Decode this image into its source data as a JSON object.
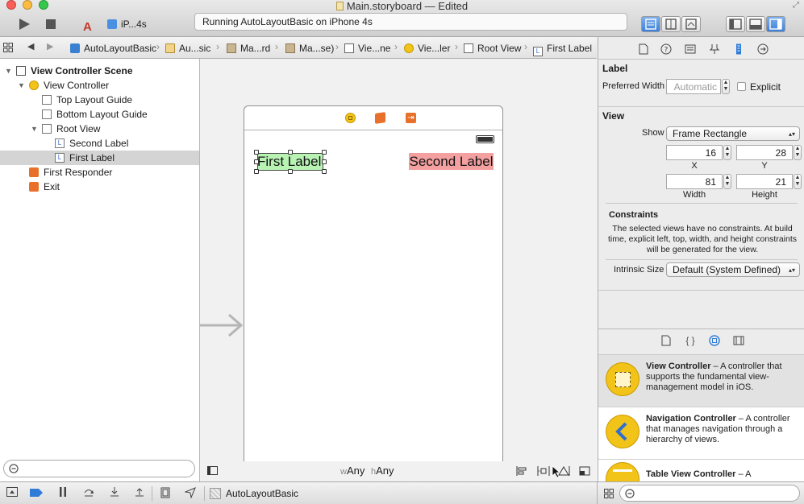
{
  "window": {
    "title": "Main.storyboard — Edited",
    "scheme_target": "iP...4s",
    "activity": "Running AutoLayoutBasic on iPhone 4s"
  },
  "jumpbar": {
    "crumbs": [
      "AutoLayoutBasic",
      "Au...sic",
      "Ma...rd",
      "Ma...se)",
      "Vie...ne",
      "Vie...ler",
      "Root View",
      "First Label"
    ]
  },
  "outline": {
    "items": [
      {
        "label": "View Controller Scene",
        "level": 0,
        "bold": true,
        "icon": "scene-icon"
      },
      {
        "label": "View Controller",
        "level": 1,
        "icon": "view-controller-icon"
      },
      {
        "label": "Top Layout Guide",
        "level": 2,
        "icon": "layout-guide-icon"
      },
      {
        "label": "Bottom Layout Guide",
        "level": 2,
        "icon": "layout-guide-icon"
      },
      {
        "label": "Root View",
        "level": 2,
        "icon": "view-icon"
      },
      {
        "label": "Second Label",
        "level": 3,
        "icon": "label-icon"
      },
      {
        "label": "First Label",
        "level": 3,
        "icon": "label-icon",
        "selected": true
      },
      {
        "label": "First Responder",
        "level": 1,
        "icon": "first-responder-icon"
      },
      {
        "label": "Exit",
        "level": 1,
        "icon": "exit-icon"
      }
    ]
  },
  "canvas": {
    "first_label": "First Label",
    "second_label": "Second Label",
    "size_class_w_prefix": "w",
    "size_class_w": "Any",
    "size_class_h_prefix": "h",
    "size_class_h": "Any"
  },
  "inspector": {
    "label_section": "Label",
    "preferred_width_label": "Preferred Width",
    "preferred_width_value": "Automatic",
    "explicit_label": "Explicit",
    "view_section": "View",
    "show_label": "Show",
    "show_value": "Frame Rectangle",
    "x_value": "16",
    "y_value": "28",
    "x_label": "X",
    "y_label": "Y",
    "width_value": "81",
    "height_value": "21",
    "width_label": "Width",
    "height_label": "Height",
    "constraints_title": "Constraints",
    "constraints_text": "The selected views have no constraints. At build time, explicit left, top, width, and height constraints will be generated for the view.",
    "intrinsic_label": "Intrinsic Size",
    "intrinsic_value": "Default (System Defined)"
  },
  "library": [
    {
      "title": "View Controller",
      "desc": " – A controller that supports the fundamental view-management model in iOS.",
      "icon": "view-controller-icon"
    },
    {
      "title": "Navigation Controller",
      "desc": " – A controller that manages navigation through a hierarchy of views.",
      "icon": "navigation-controller-icon"
    },
    {
      "title": "Table View Controller",
      "desc": " – A",
      "icon": "table-view-controller-icon"
    }
  ],
  "debug": {
    "process": "AutoLayoutBasic"
  },
  "colors": {
    "first_label_bg": "#b8f3b4",
    "second_label_bg": "#f4a0a0",
    "accent": "#2f7bd8",
    "vc_yellow": "#f2c318",
    "orange": "#e8702a"
  }
}
